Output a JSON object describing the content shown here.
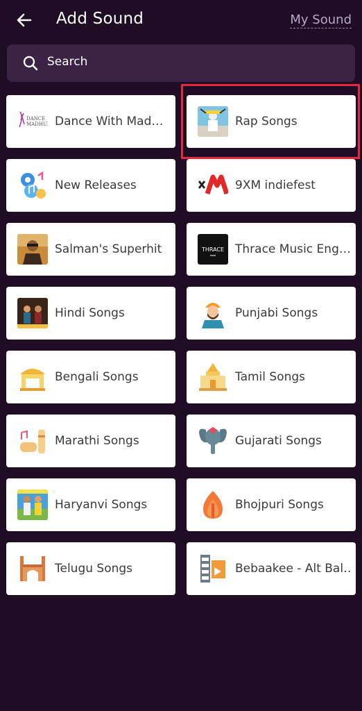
{
  "header": {
    "title": "Add Sound",
    "my_sound_label": "My Sound"
  },
  "search": {
    "placeholder": "Search"
  },
  "categories": [
    {
      "label": "Dance With Mad…",
      "icon": "dance-madhuri-logo"
    },
    {
      "label": "Rap Songs",
      "icon": "rap-cover-art",
      "highlighted": true
    },
    {
      "label": "New Releases",
      "icon": "music-notes-icon"
    },
    {
      "label": "9XM indiefest",
      "icon": "9xm-logo"
    },
    {
      "label": "Salman's Superhit",
      "icon": "salman-photo"
    },
    {
      "label": "Thrace Music Eng…",
      "icon": "thrace-logo"
    },
    {
      "label": "Hindi Songs",
      "icon": "hindi-poster"
    },
    {
      "label": "Punjabi Songs",
      "icon": "turban-man-icon"
    },
    {
      "label": "Bengali Songs",
      "icon": "bengali-temple-icon"
    },
    {
      "label": "Tamil Songs",
      "icon": "tamil-temple-icon"
    },
    {
      "label": "Marathi Songs",
      "icon": "drum-icon"
    },
    {
      "label": "Gujarati Songs",
      "icon": "elephant-icon"
    },
    {
      "label": "Haryanvi Songs",
      "icon": "haryanvi-photo"
    },
    {
      "label": "Bhojpuri Songs",
      "icon": "flame-icon"
    },
    {
      "label": "Telugu Songs",
      "icon": "charminar-icon"
    },
    {
      "label": "Bebaakee - Alt Bal…",
      "icon": "film-reel-icon"
    }
  ],
  "colors": {
    "background": "#1e0d24",
    "search_bg": "#3a2345",
    "highlight": "#e8273e"
  }
}
